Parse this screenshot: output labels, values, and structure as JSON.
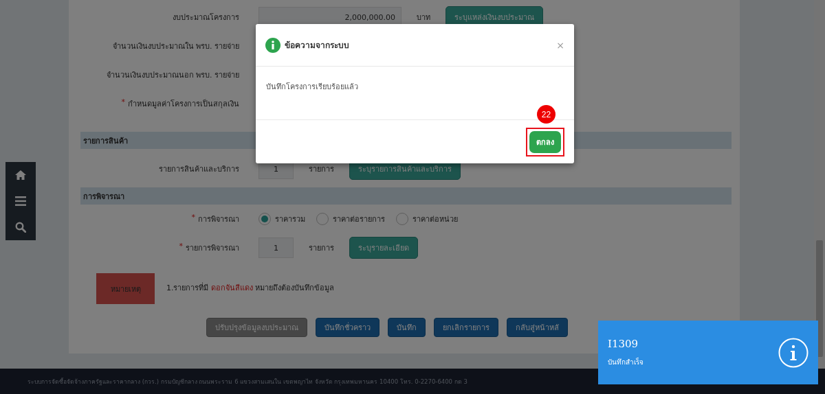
{
  "budget_rows": [
    {
      "kind": "amount",
      "label": "งบประมาณโครงการ",
      "value": "2,000,000.00",
      "unit": "บาท",
      "button": "ระบุแหล่งเงินงบประมาณ"
    },
    {
      "kind": "plain",
      "label": "จำนวนเงินงบประมาณใน พรบ. รายจ่าย"
    },
    {
      "kind": "plain",
      "label": "จำนวนเงินงบประมาณนอก พรบ. รายจ่าย"
    },
    {
      "kind": "plain",
      "required_mark": "*",
      "label": "กำหนดมูลค่าโครงการเป็นสกุลเงิน"
    }
  ],
  "sections": [
    {
      "title": "รายการสินค้า",
      "rows": [
        {
          "kind": "count",
          "label": "รายการสินค้าและบริการ",
          "value": "1",
          "unit": "รายการ",
          "button": "ระบุรายการสินค้าและบริการ"
        }
      ]
    },
    {
      "title": "การพิจารณา",
      "rows": [
        {
          "kind": "radio",
          "required_mark": "*",
          "label": "การพิจารณา",
          "options": [
            {
              "label": "ราคารวม",
              "selected": true
            },
            {
              "label": "ราคาต่อรายการ",
              "selected": false
            },
            {
              "label": "ราคาต่อหน่วย",
              "selected": false
            }
          ]
        },
        {
          "kind": "count",
          "required_mark": "*",
          "label": "รายการพิจารณา",
          "value": "1",
          "unit": "รายการ",
          "button": "ระบุรายละเอียด"
        }
      ]
    }
  ],
  "note": {
    "badge": "หมายเหตุ",
    "text": "1.รายการที่มี **ดอกจันสีแดง** หมายถึงต้องบันทึกข้อมูล"
  },
  "actions": [
    {
      "label": "ปรับปรุงข้อมูลงบประมาณ",
      "disabled": true
    },
    {
      "label": "บันทึกชั่วคราว",
      "disabled": false
    },
    {
      "label": "บันทึก",
      "disabled": false
    },
    {
      "label": "ยกเลิกรายการ",
      "disabled": false
    },
    {
      "label": "กลับสู่หน้าหลั",
      "disabled": false
    }
  ],
  "footer": "ระบบการจัดซื้อจัดจ้างภาครัฐและราคากลาง (กวร.) กรมบัญชีกลาง ถนนพระราม 6 แขวงสามเสนใน เขตพญาไท จังหวัด กรุงเทพมหานคร 10400 โทร. 0-2270-6400 กด 3",
  "modal": {
    "title": "ข้อความจากระบบ",
    "close": "×",
    "message": "บันทึกโครงการเรียบร้อยแล้ว",
    "ok": "ตกลง",
    "annotation": "22"
  },
  "toast": {
    "code": "I1309",
    "message": "บันทึกสำเร็จ"
  }
}
